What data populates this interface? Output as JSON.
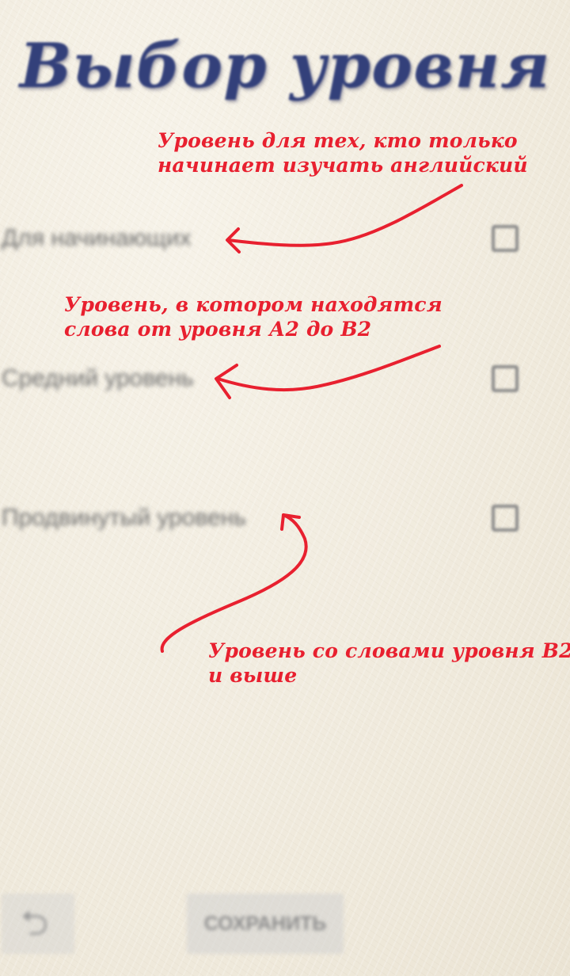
{
  "screen": {
    "title": "Выбор уровня"
  },
  "levels": [
    {
      "label": "Для начинающих",
      "checked": false
    },
    {
      "label": "Средний уровень",
      "checked": false
    },
    {
      "label": "Продвинутый уровень",
      "checked": false
    }
  ],
  "annotations": [
    {
      "line1": "Уровень для тех, кто только",
      "line2": "начинает изучать английский"
    },
    {
      "line1": "Уровень, в котором находятся",
      "line2": "слова от уровня А2 до В2"
    },
    {
      "line1": "Уровень со словами уровня В2",
      "line2": "и выше"
    }
  ],
  "footer": {
    "back_icon": "back-arrow-icon",
    "save_label": "СОХРАНИТЬ"
  },
  "colors": {
    "title": "#33407a",
    "annotation": "#e8202f",
    "background": "#f3eee2"
  }
}
